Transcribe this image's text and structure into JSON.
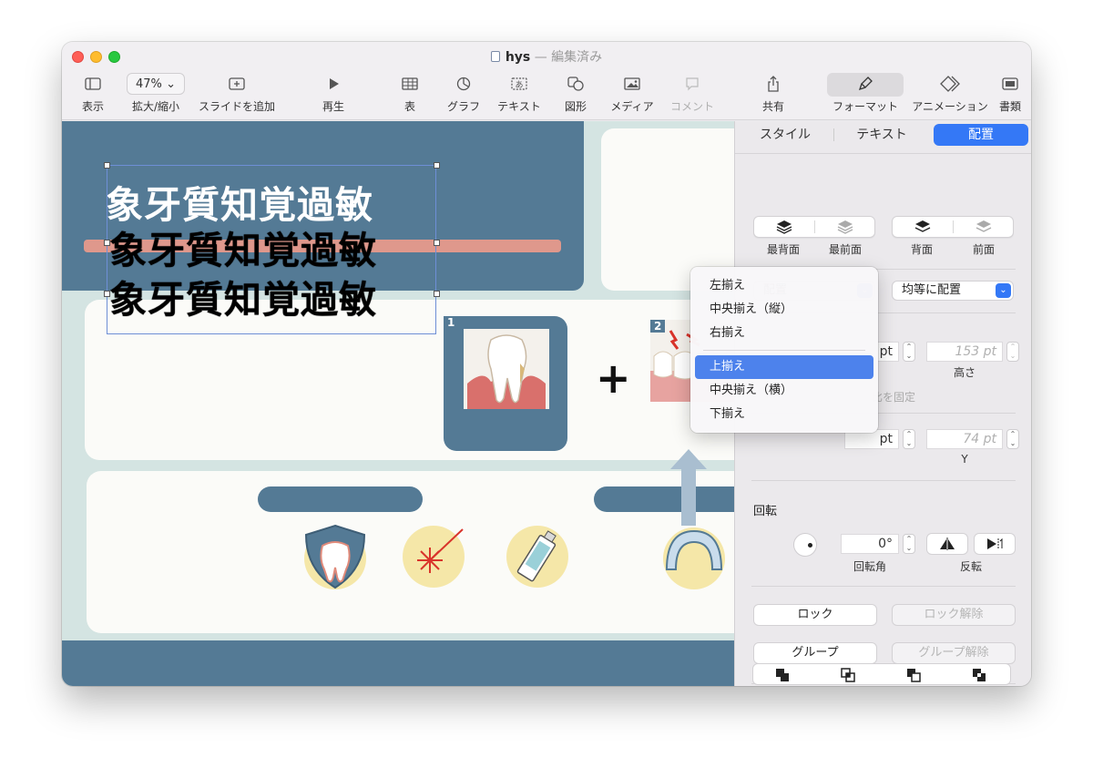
{
  "window": {
    "title": "hys",
    "title_separator": "—",
    "status": "編集済み"
  },
  "toolbar": {
    "view": "表示",
    "zoom_value": "47%",
    "zoom": "拡大/縮小",
    "add_slide": "スライドを追加",
    "play": "再生",
    "table": "表",
    "chart": "グラフ",
    "text": "テキスト",
    "shape": "図形",
    "media": "メディア",
    "comment": "コメント",
    "share": "共有",
    "format": "フォーマット",
    "animate": "アニメーション",
    "document": "書類"
  },
  "slide": {
    "headline_line1": "象牙質知覚過敏",
    "headline_line2": "象牙質知覚過敏",
    "tile1_number": "1",
    "tile2_number": "2",
    "plus": "+"
  },
  "inspector": {
    "tabs": [
      "スタイル",
      "テキスト",
      "配置"
    ],
    "active_tab": "配置",
    "arrange": {
      "back_most": "最背面",
      "front_most": "最前面",
      "backward": "背面",
      "forward": "前面"
    },
    "align_popup": "配置",
    "distribute_popup": "均等に配置",
    "size": {
      "width_unit": "pt",
      "height_value": "153 pt",
      "height_label": "高さ",
      "constrain": "比を固定"
    },
    "position": {
      "x_unit": "pt",
      "y_value": "74 pt",
      "y_label": "Y"
    },
    "rotate": {
      "section": "回転",
      "angle_value": "0°",
      "angle_label": "回転角",
      "flip_label": "反転"
    },
    "lock": "ロック",
    "unlock": "ロック解除",
    "group": "グループ",
    "ungroup": "グループ解除"
  },
  "align_menu": {
    "items": [
      "左揃え",
      "中央揃え（縦）",
      "右揃え"
    ],
    "items2": [
      "上揃え",
      "中央揃え（横）",
      "下揃え"
    ],
    "selected": "上揃え"
  },
  "colors": {
    "accent": "#3478f6",
    "slide_blue": "#547a95",
    "slide_teal": "#d4e4e2",
    "highlight_pink": "#e79a8b"
  }
}
